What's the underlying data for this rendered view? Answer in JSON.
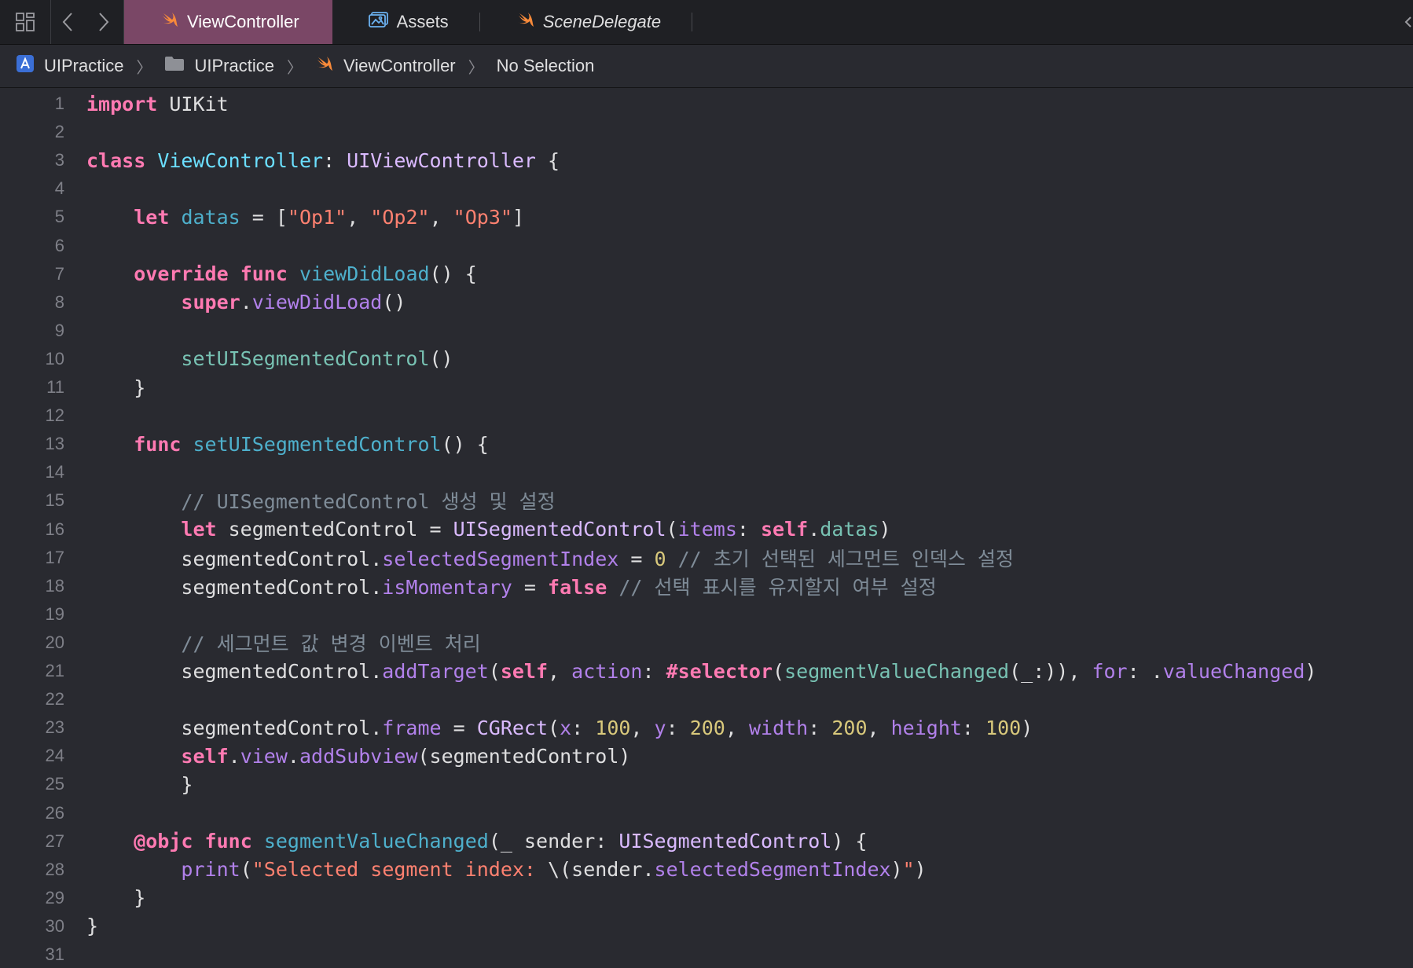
{
  "tabs": [
    {
      "label": "ViewController",
      "active": true,
      "icon": "swift-icon"
    },
    {
      "label": "Assets",
      "active": false,
      "icon": "assets-catalog-icon"
    },
    {
      "label": "SceneDelegate",
      "active": false,
      "icon": "swift-icon"
    }
  ],
  "breadcrumb": {
    "project": "UIPractice",
    "group": "UIPractice",
    "file": "ViewController",
    "selection": "No Selection"
  },
  "code_lines": [
    {
      "n": "1",
      "tokens": [
        [
          "kw",
          "import"
        ],
        [
          "tx",
          " UIKit"
        ]
      ]
    },
    {
      "n": "2",
      "tokens": []
    },
    {
      "n": "3",
      "tokens": [
        [
          "kw",
          "class"
        ],
        [
          "tx",
          " "
        ],
        [
          "decl",
          "ViewController"
        ],
        [
          "tx",
          ": "
        ],
        [
          "type",
          "UIViewController"
        ],
        [
          "tx",
          " {"
        ]
      ]
    },
    {
      "n": "4",
      "tokens": []
    },
    {
      "n": "5",
      "tokens": [
        [
          "tx",
          "    "
        ],
        [
          "kw",
          "let"
        ],
        [
          "tx",
          " "
        ],
        [
          "prop",
          "datas"
        ],
        [
          "tx",
          " = ["
        ],
        [
          "str",
          "\"Op1\""
        ],
        [
          "tx",
          ", "
        ],
        [
          "str",
          "\"Op2\""
        ],
        [
          "tx",
          ", "
        ],
        [
          "str",
          "\"Op3\""
        ],
        [
          "tx",
          "]"
        ]
      ]
    },
    {
      "n": "6",
      "tokens": []
    },
    {
      "n": "7",
      "tokens": [
        [
          "tx",
          "    "
        ],
        [
          "kw",
          "override"
        ],
        [
          "tx",
          " "
        ],
        [
          "kw",
          "func"
        ],
        [
          "tx",
          " "
        ],
        [
          "prop",
          "viewDidLoad"
        ],
        [
          "tx",
          "() {"
        ]
      ]
    },
    {
      "n": "8",
      "tokens": [
        [
          "tx",
          "        "
        ],
        [
          "kw",
          "super"
        ],
        [
          "tx",
          "."
        ],
        [
          "pl",
          "viewDidLoad"
        ],
        [
          "tx",
          "()"
        ]
      ]
    },
    {
      "n": "9",
      "tokens": []
    },
    {
      "n": "10",
      "tokens": [
        [
          "tx",
          "        "
        ],
        [
          "fn",
          "setUISegmentedControl"
        ],
        [
          "tx",
          "()"
        ]
      ]
    },
    {
      "n": "11",
      "tokens": [
        [
          "tx",
          "    }"
        ]
      ]
    },
    {
      "n": "12",
      "tokens": []
    },
    {
      "n": "13",
      "tokens": [
        [
          "tx",
          "    "
        ],
        [
          "kw",
          "func"
        ],
        [
          "tx",
          " "
        ],
        [
          "prop",
          "setUISegmentedControl"
        ],
        [
          "tx",
          "() {"
        ]
      ]
    },
    {
      "n": "14",
      "tokens": []
    },
    {
      "n": "15",
      "tokens": [
        [
          "tx",
          "        "
        ],
        [
          "com",
          "// UISegmentedControl 생성 및 설정"
        ]
      ]
    },
    {
      "n": "16",
      "tokens": [
        [
          "tx",
          "        "
        ],
        [
          "kw",
          "let"
        ],
        [
          "tx",
          " segmentedControl = "
        ],
        [
          "type",
          "UISegmentedControl"
        ],
        [
          "tx",
          "("
        ],
        [
          "pl",
          "items"
        ],
        [
          "tx",
          ": "
        ],
        [
          "kw",
          "self"
        ],
        [
          "tx",
          "."
        ],
        [
          "fn",
          "datas"
        ],
        [
          "tx",
          ")"
        ]
      ]
    },
    {
      "n": "17",
      "tokens": [
        [
          "tx",
          "        segmentedControl."
        ],
        [
          "pl",
          "selectedSegmentIndex"
        ],
        [
          "tx",
          " = "
        ],
        [
          "num",
          "0"
        ],
        [
          "tx",
          " "
        ],
        [
          "com",
          "// 초기 선택된 세그먼트 인덱스 설정"
        ]
      ]
    },
    {
      "n": "18",
      "tokens": [
        [
          "tx",
          "        segmentedControl."
        ],
        [
          "pl",
          "isMomentary"
        ],
        [
          "tx",
          " = "
        ],
        [
          "kw",
          "false"
        ],
        [
          "tx",
          " "
        ],
        [
          "com",
          "// 선택 표시를 유지할지 여부 설정"
        ]
      ]
    },
    {
      "n": "19",
      "tokens": []
    },
    {
      "n": "20",
      "tokens": [
        [
          "tx",
          "        "
        ],
        [
          "com",
          "// 세그먼트 값 변경 이벤트 처리"
        ]
      ]
    },
    {
      "n": "21",
      "tokens": [
        [
          "tx",
          "        segmentedControl."
        ],
        [
          "pl",
          "addTarget"
        ],
        [
          "tx",
          "("
        ],
        [
          "kw",
          "self"
        ],
        [
          "tx",
          ", "
        ],
        [
          "pl",
          "action"
        ],
        [
          "tx",
          ": "
        ],
        [
          "kw",
          "#selector"
        ],
        [
          "tx",
          "("
        ],
        [
          "fn",
          "segmentValueChanged"
        ],
        [
          "tx",
          "(_:)), "
        ],
        [
          "pl",
          "for"
        ],
        [
          "tx",
          ": ."
        ],
        [
          "pl",
          "valueChanged"
        ],
        [
          "tx",
          ")"
        ]
      ]
    },
    {
      "n": "22",
      "tokens": []
    },
    {
      "n": "23",
      "tokens": [
        [
          "tx",
          "        segmentedControl."
        ],
        [
          "pl",
          "frame"
        ],
        [
          "tx",
          " = "
        ],
        [
          "type",
          "CGRect"
        ],
        [
          "tx",
          "("
        ],
        [
          "pl",
          "x"
        ],
        [
          "tx",
          ": "
        ],
        [
          "num",
          "100"
        ],
        [
          "tx",
          ", "
        ],
        [
          "pl",
          "y"
        ],
        [
          "tx",
          ": "
        ],
        [
          "num",
          "200"
        ],
        [
          "tx",
          ", "
        ],
        [
          "pl",
          "width"
        ],
        [
          "tx",
          ": "
        ],
        [
          "num",
          "200"
        ],
        [
          "tx",
          ", "
        ],
        [
          "pl",
          "height"
        ],
        [
          "tx",
          ": "
        ],
        [
          "num",
          "100"
        ],
        [
          "tx",
          ")"
        ]
      ]
    },
    {
      "n": "24",
      "tokens": [
        [
          "tx",
          "        "
        ],
        [
          "kw",
          "self"
        ],
        [
          "tx",
          "."
        ],
        [
          "pl",
          "view"
        ],
        [
          "tx",
          "."
        ],
        [
          "pl",
          "addSubview"
        ],
        [
          "tx",
          "(segmentedControl)"
        ]
      ]
    },
    {
      "n": "25",
      "tokens": [
        [
          "tx",
          "        }"
        ]
      ]
    },
    {
      "n": "26",
      "tokens": []
    },
    {
      "n": "27",
      "tokens": [
        [
          "tx",
          "    "
        ],
        [
          "kw",
          "@objc"
        ],
        [
          "tx",
          " "
        ],
        [
          "kw",
          "func"
        ],
        [
          "tx",
          " "
        ],
        [
          "prop",
          "segmentValueChanged"
        ],
        [
          "tx",
          "(_ sender: "
        ],
        [
          "type",
          "UISegmentedControl"
        ],
        [
          "tx",
          ") {"
        ]
      ]
    },
    {
      "n": "28",
      "tokens": [
        [
          "tx",
          "        "
        ],
        [
          "pl",
          "print"
        ],
        [
          "tx",
          "("
        ],
        [
          "str",
          "\"Selected segment index: "
        ],
        [
          "tx",
          "\\(sender."
        ],
        [
          "pl",
          "selectedSegmentIndex"
        ],
        [
          "tx",
          ")"
        ],
        [
          "str",
          "\""
        ],
        [
          "tx",
          ")"
        ]
      ]
    },
    {
      "n": "29",
      "tokens": [
        [
          "tx",
          "    }"
        ]
      ]
    },
    {
      "n": "30",
      "tokens": [
        [
          "tx",
          "}"
        ]
      ]
    },
    {
      "n": "31",
      "tokens": []
    }
  ],
  "colors": {
    "background": "#292a30",
    "active_tab": "#7a4766",
    "keyword": "#ff7ab2",
    "string": "#ff8170",
    "comment": "#7f8c98",
    "number": "#d9c97c",
    "type": "#dabaff"
  }
}
